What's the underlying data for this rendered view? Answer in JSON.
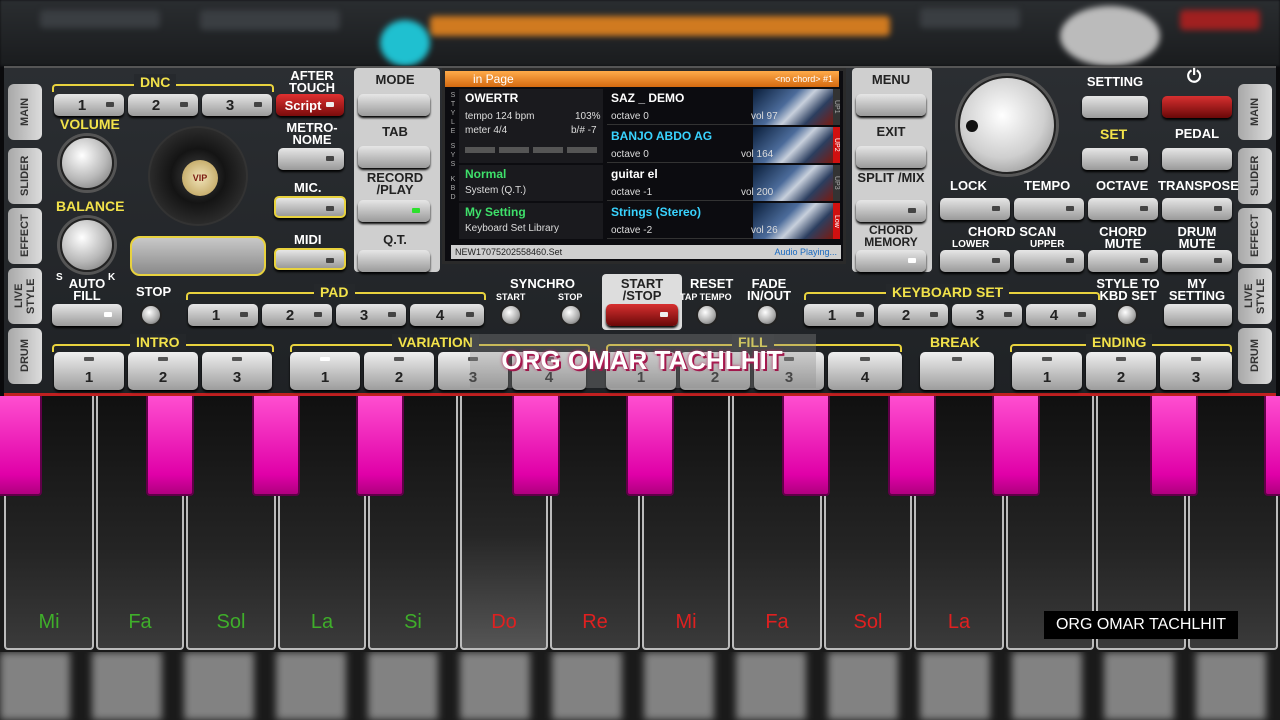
{
  "left_tabs": [
    "MAIN",
    "SLIDER",
    "EFFECT",
    "LIVE STYLE",
    "DRUM"
  ],
  "right_tabs": [
    "MAIN",
    "SLIDER",
    "EFFECT",
    "LIVE STYLE",
    "DRUM"
  ],
  "dnc": {
    "label": "DNC",
    "buttons": [
      "1",
      "2",
      "3"
    ]
  },
  "after_touch": {
    "label": "AFTER TOUCH",
    "script": "Script"
  },
  "volume_label": "VOLUME",
  "balance_label": "BALANCE",
  "balance_s": "S",
  "balance_k": "K",
  "vip_label": "VIP",
  "metronome_label": "METRO- NOME",
  "mic_label": "MIC.",
  "midi_label": "MIDI",
  "mode_label": "MODE",
  "tab_label": "TAB",
  "record_label": "RECORD /PLAY",
  "qt_label": "Q.T.",
  "menu_label": "MENU",
  "exit_label": "EXIT",
  "split_label": "SPLIT /MIX",
  "chord_memory_label": "CHORD MEMORY",
  "screen": {
    "header": "in Page",
    "header_right": "<no chord> #1",
    "style_name": "OWERTR",
    "tempo": "tempo 124 bpm",
    "tempo_pct": "103%",
    "meter": "meter 4/4",
    "transpose": "b/# -7",
    "normal": "Normal",
    "system": "System (Q.T.)",
    "my_setting": "My Setting",
    "library": "Keyboard Set Library",
    "file": "NEW17075202558460.Set",
    "audio": "Audio Playing...",
    "left_strip": "S T Y L E",
    "left_strip2": "S Y S",
    "left_strip3": "K B D",
    "parts": [
      {
        "name": "SAZ _ DEMO",
        "octave": "octave  0",
        "vol": "vol 97",
        "tag": "UP1"
      },
      {
        "name": "BANJO ABDO AG",
        "octave": "octave  0",
        "vol": "vol 164",
        "tag": "UP2"
      },
      {
        "name": "guitar el",
        "octave": "octave -1",
        "vol": "vol 200",
        "tag": "UP3"
      },
      {
        "name": "Strings (Stereo)",
        "octave": "octave -2",
        "vol": "vol 26",
        "tag": "Low"
      }
    ]
  },
  "setting_label": "SETTING",
  "set_label": "SET",
  "pedal_label": "PEDAL",
  "lock_label": "LOCK",
  "tempo_label": "TEMPO",
  "octave_label": "OCTAVE",
  "transpose_label": "TRANSPOSE",
  "chord_scan": "CHORD SCAN",
  "lower": "LOWER",
  "upper": "UPPER",
  "chord_mute": "CHORD MUTE",
  "drum_mute": "DRUM MUTE",
  "auto_fill": "AUTO FILL",
  "stop": "STOP",
  "pad": {
    "label": "PAD",
    "buttons": [
      "1",
      "2",
      "3",
      "4"
    ]
  },
  "synchro": "SYNCHRO",
  "synchro_start": "START",
  "synchro_stop": "STOP",
  "start_stop": "START /STOP",
  "reset": "RESET",
  "tap_tempo": "TAP TEMPO",
  "fade": "FADE IN/OUT",
  "keyboard_set": {
    "label": "KEYBOARD SET",
    "buttons": [
      "1",
      "2",
      "3",
      "4"
    ]
  },
  "style_to_kbd": "STYLE TO KBD SET",
  "my_setting_btn": "MY SETTING",
  "intro": {
    "label": "INTRO",
    "buttons": [
      "1",
      "2",
      "3"
    ]
  },
  "variation": {
    "label": "VARIATION",
    "buttons": [
      "1",
      "2",
      "3",
      "4"
    ]
  },
  "fill": {
    "label": "FILL",
    "buttons": [
      "1",
      "2",
      "3",
      "4"
    ]
  },
  "break_label": "BREAK",
  "ending": {
    "label": "ENDING",
    "buttons": [
      "1",
      "2",
      "3"
    ]
  },
  "watermark": "ORG OMAR TACHLHIT",
  "watermark2": "ORG OMAR TACHLHIT",
  "keys": [
    {
      "label": "Mi",
      "color": "#3fae2a"
    },
    {
      "label": "Fa",
      "color": "#3fae2a"
    },
    {
      "label": "Sol",
      "color": "#3fae2a"
    },
    {
      "label": "La",
      "color": "#3fae2a"
    },
    {
      "label": "Si",
      "color": "#3fae2a"
    },
    {
      "label": "Do",
      "color": "#e02020"
    },
    {
      "label": "Re",
      "color": "#e02020"
    },
    {
      "label": "Mi",
      "color": "#e02020"
    },
    {
      "label": "Fa",
      "color": "#e02020"
    },
    {
      "label": "Sol",
      "color": "#e02020"
    },
    {
      "label": "La",
      "color": "#e02020"
    },
    {
      "label": "",
      "color": "#e02020"
    },
    {
      "label": "",
      "color": "#e02020"
    }
  ]
}
